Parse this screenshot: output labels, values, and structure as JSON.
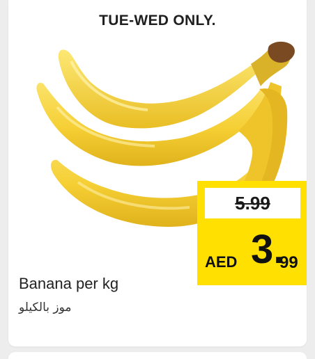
{
  "promo": {
    "tag": "TUE-WED ONLY."
  },
  "product": {
    "name_en": "Banana per kg",
    "name_ar": "موز بالكيلو",
    "image_icon": "banana-bunch-icon"
  },
  "price": {
    "old": "5.99",
    "currency": "AED",
    "whole": "3.",
    "fraction": "99"
  },
  "colors": {
    "price_box": "#ffe000",
    "banana_yellow": "#f7d23a",
    "banana_shadow": "#e3b81a",
    "stem_brown": "#7a4a22"
  }
}
